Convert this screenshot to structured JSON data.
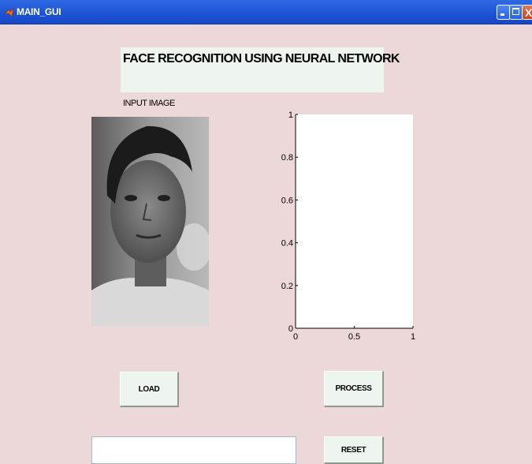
{
  "window": {
    "title": "MAIN_GUI",
    "controls": {
      "minimize_icon": "minimize-icon",
      "maximize_icon": "maximize-icon",
      "close_icon": "close-icon",
      "close_glyph": "X"
    }
  },
  "heading": {
    "text": "FACE RECOGNITION USING NEURAL NETWORK"
  },
  "input_image": {
    "label": "INPUT IMAGE"
  },
  "chart_data": {
    "type": "scatter",
    "title": "",
    "xlabel": "",
    "ylabel": "",
    "xlim": [
      0,
      1
    ],
    "ylim": [
      0,
      1
    ],
    "xticks": [
      "0",
      "0.5",
      "1"
    ],
    "yticks": [
      "0",
      "0.2",
      "0.4",
      "0.6",
      "0.8",
      "1"
    ],
    "series": []
  },
  "buttons": {
    "load": "LOAD",
    "process": "PROCESS",
    "reset": "RESET"
  },
  "output_field": {
    "value": ""
  },
  "colors": {
    "window_bg": "#ecd8d8",
    "titlebar": "#1d54d6",
    "panel_bg": "#eef4ee"
  }
}
